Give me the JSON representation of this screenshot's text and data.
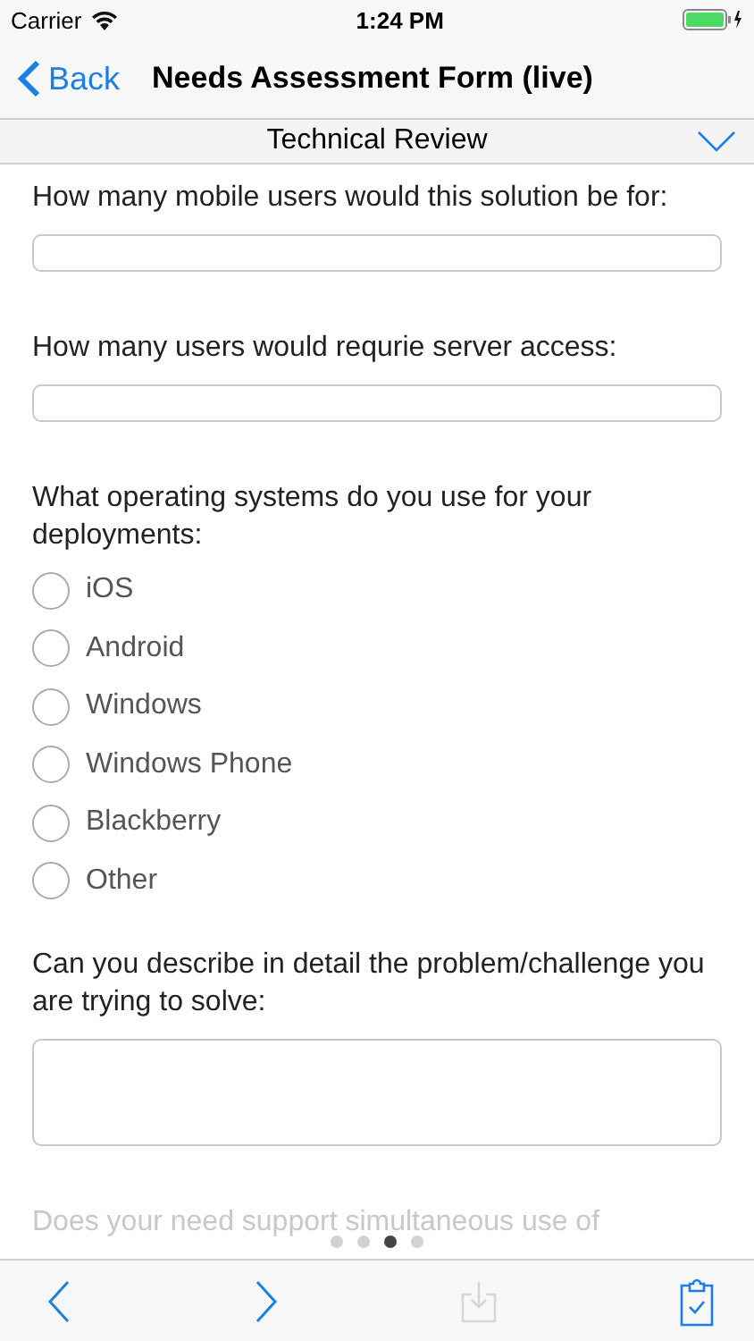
{
  "status_bar": {
    "carrier": "Carrier",
    "time": "1:24 PM"
  },
  "nav": {
    "back": "Back",
    "title": "Needs Assessment Form (live)"
  },
  "section": {
    "title": "Technical Review",
    "expanded": false
  },
  "questions": [
    {
      "kind": "text",
      "label": "How many mobile users would this solution be for:"
    },
    {
      "kind": "text",
      "label": "How many users would requrie server access:"
    },
    {
      "kind": "choice",
      "label": "What operating systems do you use for your deployments:",
      "options": [
        {
          "label": "iOS",
          "selected": false
        },
        {
          "label": "Android",
          "selected": false
        },
        {
          "label": "Windows",
          "selected": false
        },
        {
          "label": "Windows Phone",
          "selected": false
        },
        {
          "label": "Blackberry",
          "selected": false
        },
        {
          "label": "Other",
          "selected": false
        }
      ]
    },
    {
      "kind": "area",
      "label": "Can you describe in detail the problem/challenge you are trying to solve:"
    },
    {
      "kind": "faded",
      "label": "Does your need support simultaneous use of"
    }
  ],
  "pages": [
    {
      "selected": false
    },
    {
      "selected": false
    },
    {
      "selected": true
    },
    {
      "selected": false
    }
  ],
  "toolbar": {
    "download_disabled": true
  }
}
